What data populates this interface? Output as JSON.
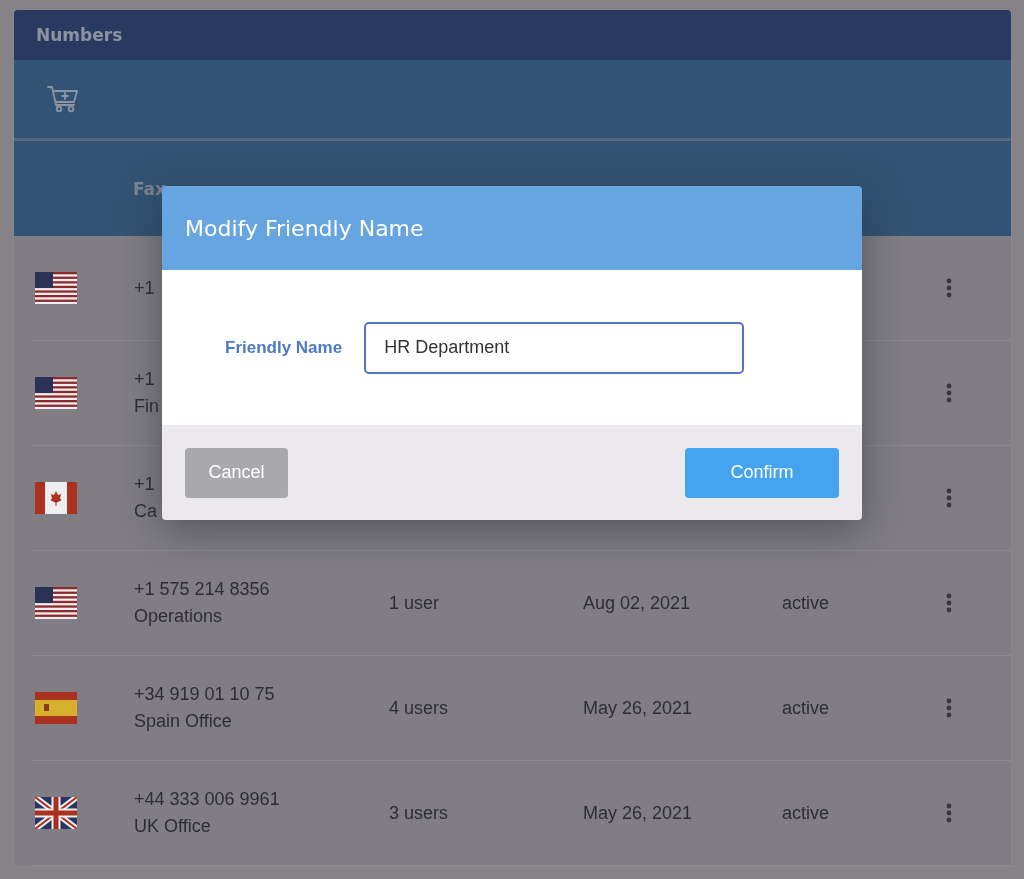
{
  "panel": {
    "title": "Numbers"
  },
  "table": {
    "columns": [
      "Fax"
    ],
    "rows": [
      {
        "kind": "us",
        "number": "+1"
      },
      {
        "kind": "us",
        "number": "+1",
        "name": "Fin"
      },
      {
        "kind": "ca",
        "number": "+1",
        "name": "Ca"
      },
      {
        "kind": "us",
        "number": "+1 575 214 8356",
        "name": "Operations",
        "assigned": "1 user",
        "date": "Aug 02, 2021",
        "status": "active"
      },
      {
        "kind": "es",
        "number": "+34 919 01 10 75",
        "name": "Spain Office",
        "assigned": "4 users",
        "date": "May 26, 2021",
        "status": "active"
      },
      {
        "kind": "gb",
        "number": "+44 333 006 9961",
        "name": "UK Office",
        "assigned": "3 users",
        "date": "May 26, 2021",
        "status": "active"
      }
    ]
  },
  "dialog": {
    "title": "Modify Friendly Name",
    "field_label": "Friendly Name",
    "field_value": "HR Department",
    "buttons": [
      {
        "label": "Cancel",
        "kind": "secondary"
      },
      {
        "label": "Confirm",
        "kind": "primary"
      }
    ]
  }
}
